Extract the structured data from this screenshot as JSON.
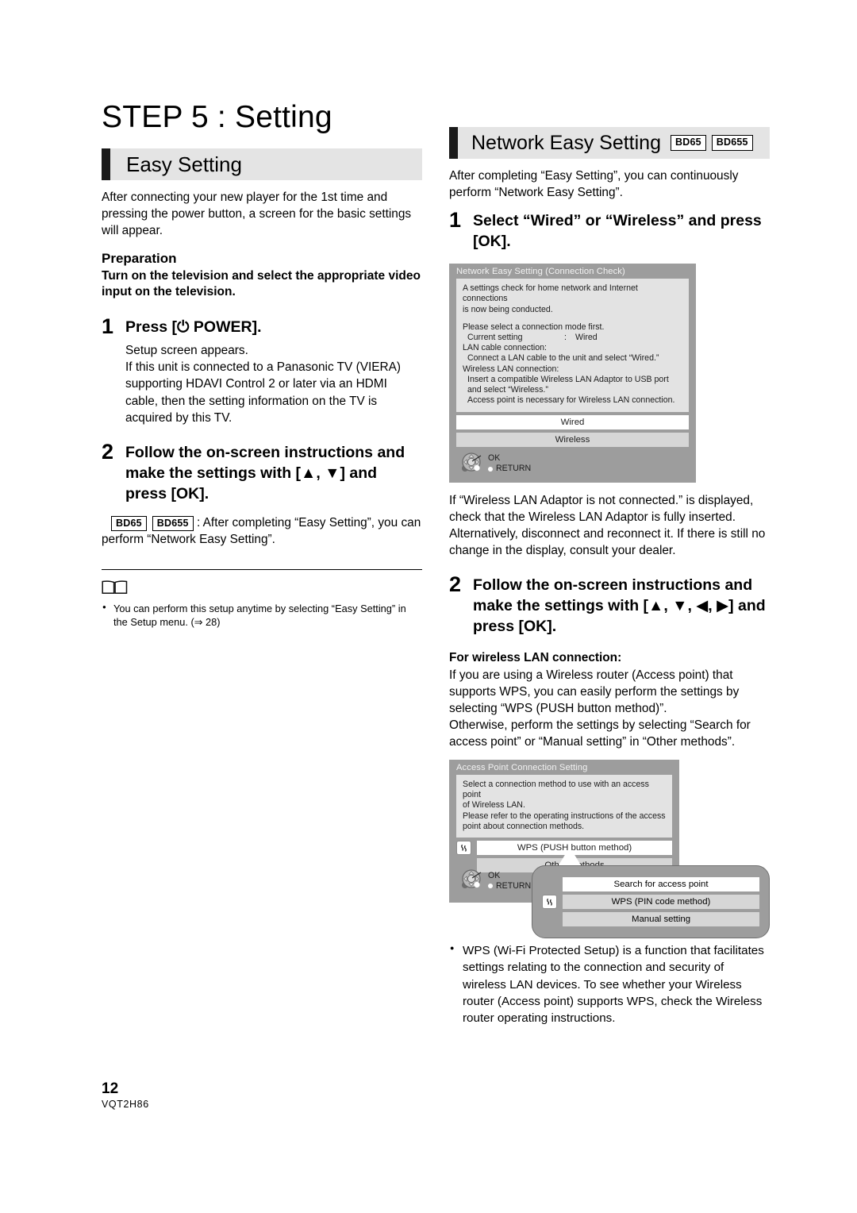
{
  "page": {
    "number": "12",
    "doc_code": "VQT2H86"
  },
  "left": {
    "step_title": "STEP 5 : Setting",
    "section": {
      "title": "Easy Setting"
    },
    "intro": "After connecting your new player for the 1st time and pressing the power button, a screen for the basic settings will appear.",
    "preparation_head": "Preparation",
    "preparation_text": "Turn on the television and select the appropriate video input on the television.",
    "step1": {
      "num": "1",
      "title_pre": "Press [",
      "power_glyph": "⏻",
      "title_post": " POWER].",
      "detail": "Setup screen appears.\nIf this unit is connected to a Panasonic TV (VIERA) supporting HDAVI Control 2 or later via an HDMI cable, then the setting information on the TV is acquired by this TV."
    },
    "step2": {
      "num": "2",
      "text": "Follow the on-screen instructions and make the settings with [▲, ▼] and press [OK]."
    },
    "badges": [
      "BD65",
      "BD655"
    ],
    "badge_note": ": After completing “Easy Setting”, you can perform “Network Easy Setting”.",
    "notes": [
      "You can perform this setup anytime by selecting “Easy Setting” in the Setup menu. (⇒ 28)"
    ]
  },
  "right": {
    "section": {
      "title": "Network Easy Setting",
      "badges": [
        "BD65",
        "BD655"
      ]
    },
    "intro": "After completing “Easy Setting”, you can continuously perform “Network Easy Setting”.",
    "step1": {
      "num": "1",
      "text": "Select “Wired” or “Wireless” and press [OK]."
    },
    "screen1": {
      "title": "Network Easy Setting (Connection Check)",
      "lines": [
        "A settings check for home network and Internet connections",
        "is now being conducted."
      ],
      "line_select": "Please select a connection mode first.",
      "current_setting_label": "Current setting",
      "current_setting_sep": ":",
      "current_setting_value": "Wired",
      "lan_head": "LAN cable connection:",
      "lan_text": "Connect a LAN cable to the unit and select “Wired.”",
      "wlan_head": "Wireless LAN connection:",
      "wlan_text1": "Insert a compatible Wireless LAN Adaptor to USB port",
      "wlan_text2": "and select “Wireless.”",
      "wlan_text3": "Access point is necessary for Wireless LAN connection.",
      "options": [
        {
          "label": "Wired",
          "selected": true
        },
        {
          "label": "Wireless",
          "selected": false
        }
      ],
      "ok_label": "OK",
      "return_label": "RETURN"
    },
    "after_screen1": "If “Wireless LAN Adaptor is not connected.” is displayed, check that the Wireless LAN Adaptor is fully inserted. Alternatively, disconnect and reconnect it. If there is still no change in the display, consult your dealer.",
    "step2": {
      "num": "2",
      "text": "Follow the on-screen instructions and make the settings with [▲, ▼, ◀, ▶] and press [OK]."
    },
    "wireless_head": "For wireless LAN connection:",
    "wireless_text1": "If you are using a Wireless router (Access point) that supports WPS, you can easily perform the settings by selecting “WPS (PUSH button method)”.",
    "wireless_text2": "Otherwise, perform the settings by selecting “Search for access point” or “Manual setting” in “Other methods”.",
    "screen2": {
      "title": "Access Point Connection Setting",
      "lines": [
        "Select a connection method to use with an access point",
        "of Wireless LAN.",
        "Please refer to the operating instructions of the access",
        "point about connection methods."
      ],
      "options": [
        {
          "label": "WPS (PUSH button method)",
          "selected": true,
          "icon": "wps-icon"
        },
        {
          "label": "Other methods",
          "selected": false,
          "icon": null
        }
      ],
      "ok_label": "OK",
      "return_label": "RETURN",
      "popup_options": [
        {
          "label": "Search for access point",
          "selected": true,
          "icon": null
        },
        {
          "label": "WPS (PIN code method)",
          "selected": false,
          "icon": "wps-icon"
        },
        {
          "label": "Manual setting",
          "selected": false,
          "icon": null
        }
      ]
    },
    "notes": [
      "WPS (Wi-Fi Protected Setup) is a function that facilitates settings relating to the connection and security of wireless LAN devices. To see whether your Wireless router (Access point) supports WPS, check the Wireless router operating instructions."
    ]
  }
}
